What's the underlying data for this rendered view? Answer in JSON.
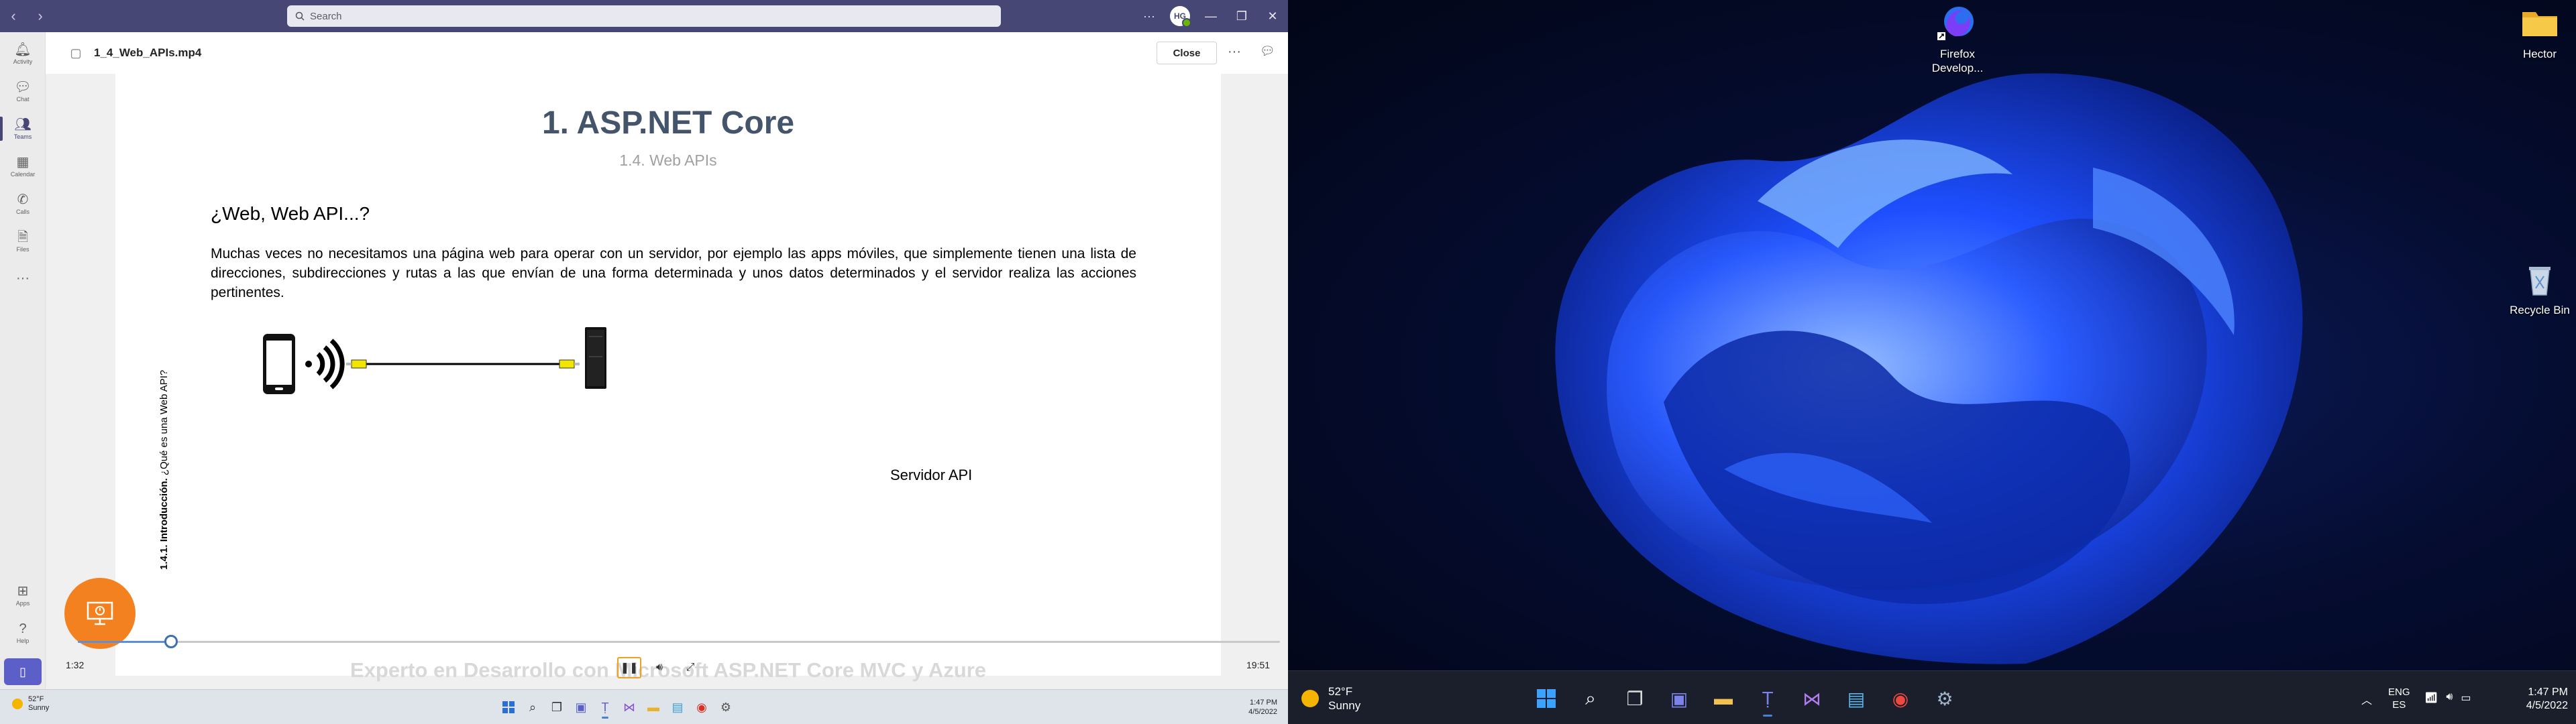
{
  "teams": {
    "search_placeholder": "Search",
    "avatar_initials": "HG",
    "rail": [
      {
        "label": "Activity",
        "icon": "bell-icon",
        "glyph": "🔔"
      },
      {
        "label": "Chat",
        "icon": "chat-icon",
        "glyph": "💬"
      },
      {
        "label": "Teams",
        "icon": "teams-icon",
        "glyph": "👥"
      },
      {
        "label": "Calendar",
        "icon": "calendar-icon",
        "glyph": "📅"
      },
      {
        "label": "Calls",
        "icon": "phone-icon",
        "glyph": "📞"
      },
      {
        "label": "Files",
        "icon": "file-icon",
        "glyph": "📄"
      }
    ],
    "rail_bottom": [
      {
        "label": "Apps",
        "icon": "apps-icon"
      },
      {
        "label": "Help",
        "icon": "help-icon"
      }
    ],
    "viewer": {
      "file_name": "1_4_Web_APIs.mp4",
      "close_label": "Close"
    },
    "slide": {
      "title": "1. ASP.NET Core",
      "subtitle": "1.4. Web APIs",
      "heading": "¿Web, Web API...?",
      "paragraph": "Muchas veces no necesitamos una página web para operar con un servidor, por ejemplo las apps móviles, que simplemente tienen una lista de direcciones, subdirecciones y rutas a las que envían de una forma determinada y unos datos determinados y el servidor realiza las acciones pertinentes.",
      "vertical_bold": "1.4.1. Introducción.",
      "vertical_rest": " ¿Qué es una Web API?",
      "server_label": "Servidor API",
      "footer": "Experto en Desarrollo con Microsoft ASP.NET Core MVC y Azure"
    },
    "player": {
      "current_time": "1:32",
      "total_time": "19:51",
      "progress_fraction": 0.0773
    }
  },
  "left_taskbar": {
    "temp": "52°F",
    "condition": "Sunny",
    "time": "1:47 PM",
    "date": "4/5/2022"
  },
  "desktop": {
    "icons": {
      "firefox": "Firefox Develop...",
      "folder": "Hector",
      "recycle": "Recycle Bin"
    },
    "taskbar": {
      "temp": "52°F",
      "condition": "Sunny",
      "lang_1": "ENG",
      "lang_2": "ES",
      "time": "1:47 PM",
      "date": "4/5/2022"
    },
    "colors": {
      "accent": "#1e4fff",
      "wallpaper_dark": "#020617"
    }
  }
}
